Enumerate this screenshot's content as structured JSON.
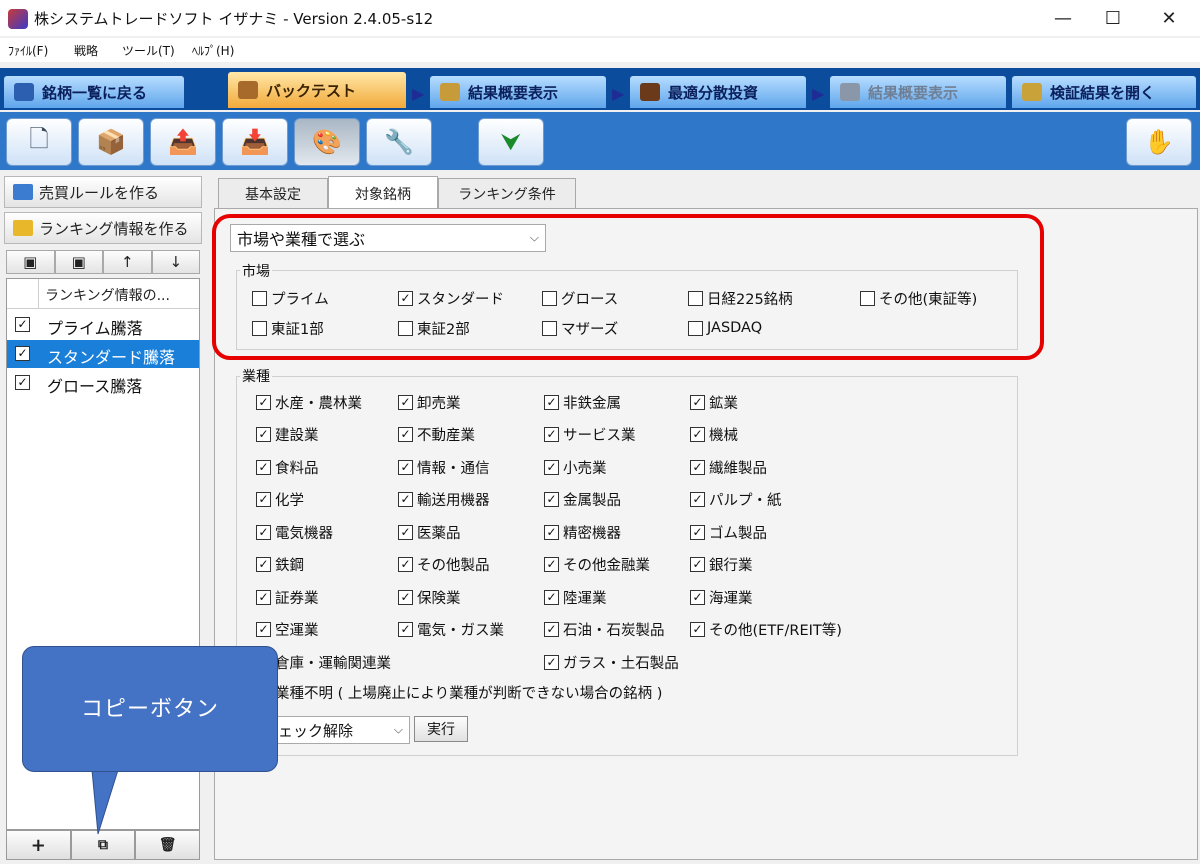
{
  "window": {
    "title": "株システムトレードソフト イザナミ - Version 2.4.05-s12",
    "min_icon": "minimize-icon",
    "max_icon": "maximize-icon",
    "close_icon": "close-icon"
  },
  "menu": {
    "file": "ﾌｧｲﾙ(F)",
    "strategy": "戦略",
    "tools": "ツール(T)",
    "help": "ﾍﾙﾌﾟ(H)"
  },
  "nav": {
    "tabs": [
      {
        "label": "銘柄一覧に戻る"
      },
      {
        "label": "バックテスト"
      },
      {
        "label": "結果概要表示"
      },
      {
        "label": "最適分散投資"
      },
      {
        "label": "結果概要表示"
      },
      {
        "label": "検証結果を開く"
      }
    ],
    "arrow": "▶"
  },
  "left": {
    "make_rule": "売買ルールを作る",
    "make_ranking": "ランキング情報を作る",
    "list_header": "ランキング情報の...",
    "rows": [
      {
        "label": "プライム騰落",
        "checked": "☑"
      },
      {
        "label": "スタンダード騰落",
        "checked": "☑"
      },
      {
        "label": "グロース騰落",
        "checked": "☑"
      }
    ],
    "check_mark": "✓",
    "tool_up": "↑",
    "tool_down": "↓",
    "add": "+",
    "copy": "⧉",
    "delete": "🗑"
  },
  "tabs": {
    "basic": "基本設定",
    "target": "対象銘柄",
    "ranking": "ランキング条件"
  },
  "select_mode": "市場や業種で選ぶ",
  "market": {
    "label": "市場",
    "items": [
      {
        "label": "プライム",
        "checked": false
      },
      {
        "label": "スタンダード",
        "checked": true
      },
      {
        "label": "グロース",
        "checked": false
      },
      {
        "label": "日経225銘柄",
        "checked": false
      },
      {
        "label": "その他(東証等)",
        "checked": false
      },
      {
        "label": "東証1部",
        "checked": false
      },
      {
        "label": "東証2部",
        "checked": false
      },
      {
        "label": "マザーズ",
        "checked": false
      },
      {
        "label": "JASDAQ",
        "checked": false
      }
    ]
  },
  "industry": {
    "label": "業種",
    "items": [
      "水産・農林業",
      "卸売業",
      "非鉄金属",
      "鉱業",
      "建設業",
      "不動産業",
      "サービス業",
      "機械",
      "食料品",
      "情報・通信",
      "小売業",
      "繊維製品",
      "化学",
      "輸送用機器",
      "金属製品",
      "パルプ・紙",
      "電気機器",
      "医薬品",
      "精密機器",
      "ゴム製品",
      "鉄鋼",
      "その他製品",
      "その他金融業",
      "銀行業",
      "証券業",
      "保険業",
      "陸運業",
      "海運業",
      "空運業",
      "電気・ガス業",
      "石油・石炭製品",
      "その他(ETF/REIT等)",
      "倉庫・運輸関連業",
      "ガラス・土石製品"
    ],
    "unknown": "業種不明 ( 上場廃止により業種が判断できない場合の銘柄 )",
    "action_select": "チェック解除",
    "exec": "実行"
  },
  "callout": "コピーボタン",
  "colors": {
    "accent_red": "#e60000",
    "selection_blue": "#1a7fd9",
    "callout_blue": "#4472c4"
  }
}
